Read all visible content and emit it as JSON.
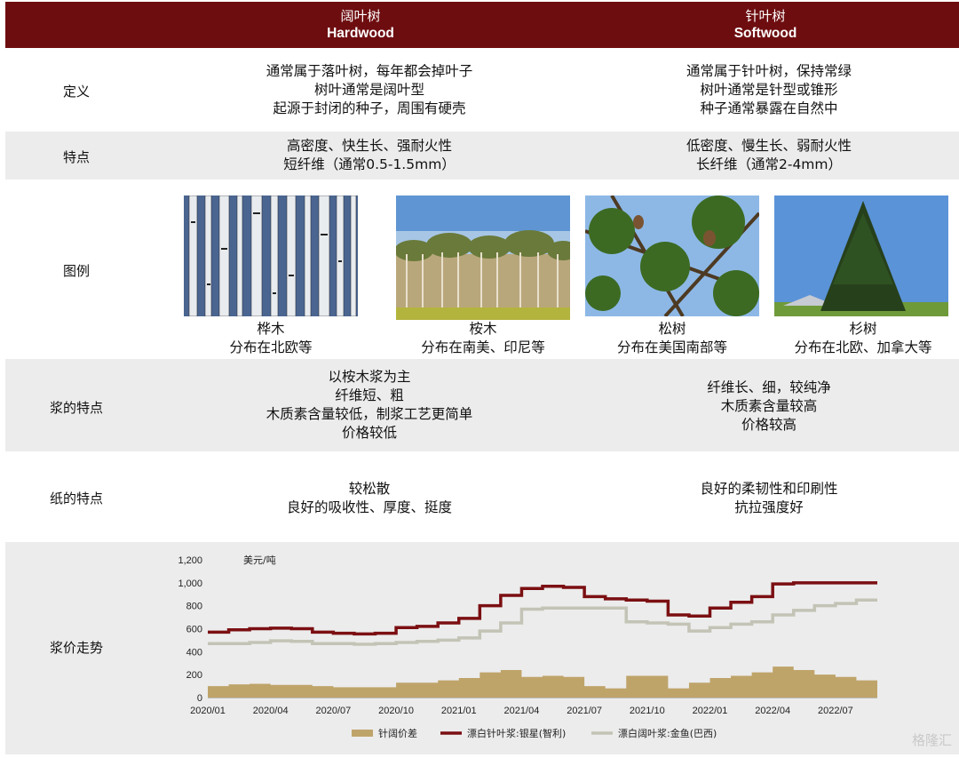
{
  "header": {
    "hardwood_cn": "阔叶树",
    "hardwood_en": "Hardwood",
    "softwood_cn": "针叶树",
    "softwood_en": "Softwood"
  },
  "rows": {
    "definition": {
      "label": "定义",
      "hardwood": [
        "通常属于落叶树，每年都会掉叶子",
        "树叶通常是阔叶型",
        "起源于封闭的种子，周围有硬壳"
      ],
      "softwood": [
        "通常属于针叶树，保持常绿",
        "树叶通常是针型或锥形",
        "种子通常暴露在自然中"
      ]
    },
    "features": {
      "label": "特点",
      "hardwood": [
        "高密度、快生长、强耐火性",
        "短纤维（通常0.5-1.5mm）"
      ],
      "softwood": [
        "低密度、慢生长、弱耐火性",
        "长纤维（通常2-4mm）"
      ]
    },
    "examples": {
      "label": "图例",
      "items": [
        {
          "name": "桦木",
          "region": "分布在北欧等"
        },
        {
          "name": "桉木",
          "region": "分布在南美、印尼等"
        },
        {
          "name": "松树",
          "region": "分布在美国南部等"
        },
        {
          "name": "杉树",
          "region": "分布在北欧、加拿大等"
        }
      ]
    },
    "pulp": {
      "label": "浆的特点",
      "hardwood": [
        "以桉木浆为主",
        "纤维短、粗",
        "木质素含量较低，制浆工艺更简单",
        "价格较低"
      ],
      "softwood": [
        "纤维长、细，较纯净",
        "木质素含量较高",
        "价格较高"
      ]
    },
    "paper": {
      "label": "纸的特点",
      "hardwood": [
        "较松散",
        "良好的吸收性、厚度、挺度"
      ],
      "softwood": [
        "良好的柔韧性和印刷性",
        "抗拉强度好"
      ]
    },
    "price": {
      "label": "浆价走势"
    }
  },
  "chart_data": {
    "type": "line",
    "unit_label": "美元/吨",
    "ylim": [
      0,
      1200
    ],
    "yticks": [
      "1,200",
      "1,000",
      "800",
      "600",
      "400",
      "200",
      "0"
    ],
    "xticks": [
      "2020/01",
      "2020/04",
      "2020/07",
      "2020/10",
      "2021/01",
      "2021/04",
      "2021/07",
      "2021/10",
      "2022/01",
      "2022/04",
      "2022/07"
    ],
    "x_months": [
      0,
      1,
      2,
      3,
      4,
      5,
      6,
      7,
      8,
      9,
      10,
      11,
      12,
      13,
      14,
      15,
      16,
      17,
      18,
      19,
      20,
      21,
      22,
      23,
      24,
      25,
      26,
      27,
      28,
      29,
      30,
      31,
      32
    ],
    "series": [
      {
        "name": "漂白针叶浆:银星(智利)",
        "color": "#7b0f12",
        "kind": "line",
        "values": [
          570,
          590,
          600,
          605,
          600,
          570,
          560,
          555,
          560,
          610,
          620,
          650,
          690,
          800,
          890,
          950,
          970,
          960,
          880,
          860,
          850,
          840,
          720,
          710,
          780,
          830,
          880,
          990,
          1000,
          1000,
          1000,
          1000,
          1000
        ]
      },
      {
        "name": "漂白阔叶浆:金鱼(巴西)",
        "color": "#c3c3b6",
        "kind": "line",
        "values": [
          470,
          470,
          480,
          495,
          490,
          470,
          470,
          465,
          470,
          480,
          490,
          500,
          520,
          580,
          650,
          770,
          780,
          780,
          780,
          780,
          660,
          650,
          640,
          580,
          610,
          640,
          660,
          720,
          760,
          800,
          820,
          850,
          850
        ]
      },
      {
        "name": "针阔价差",
        "color": "#bfa46a",
        "kind": "area",
        "values": [
          100,
          115,
          120,
          110,
          110,
          100,
          90,
          90,
          90,
          130,
          130,
          150,
          170,
          220,
          240,
          180,
          190,
          180,
          100,
          80,
          190,
          190,
          80,
          130,
          170,
          190,
          220,
          270,
          240,
          200,
          180,
          150,
          150
        ]
      }
    ]
  },
  "watermark": "格隆汇"
}
